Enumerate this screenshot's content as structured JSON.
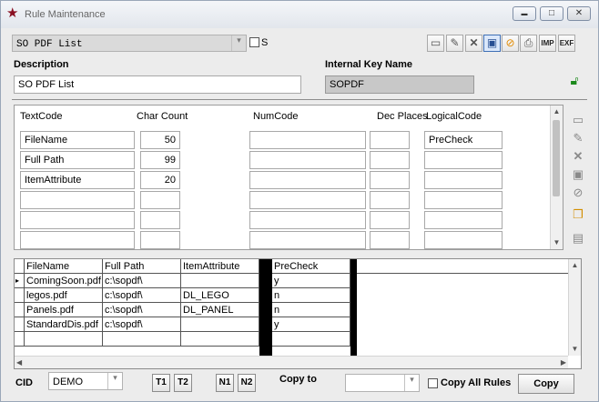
{
  "window": {
    "title": "Rule Maintenance",
    "minimize": "▬",
    "maximize": "□",
    "close": "✕"
  },
  "rule_select": {
    "value": "SO PDF List"
  },
  "s_checkbox": {
    "label": "S",
    "checked": false
  },
  "toolbar": {
    "imp_label": "IMP",
    "exf_label": "EXF"
  },
  "description": {
    "label": "Description",
    "value": "SO PDF List"
  },
  "internal_key": {
    "label": "Internal Key Name",
    "value": "SOPDF"
  },
  "fields_panel": {
    "headers": {
      "textcode": "TextCode",
      "charcount": "Char Count",
      "numcode": "NumCode",
      "decplaces": "Dec Places",
      "logicalcode": "LogicalCode"
    },
    "rows": [
      {
        "textcode": "FileName",
        "charcount": "50",
        "numcode": "",
        "decplaces": "",
        "logicalcode": "PreCheck"
      },
      {
        "textcode": "Full Path",
        "charcount": "99",
        "numcode": "",
        "decplaces": "",
        "logicalcode": ""
      },
      {
        "textcode": "ItemAttribute",
        "charcount": "20",
        "numcode": "",
        "decplaces": "",
        "logicalcode": ""
      },
      {
        "textcode": "",
        "charcount": "",
        "numcode": "",
        "decplaces": "",
        "logicalcode": ""
      },
      {
        "textcode": "",
        "charcount": "",
        "numcode": "",
        "decplaces": "",
        "logicalcode": ""
      },
      {
        "textcode": "",
        "charcount": "",
        "numcode": "",
        "decplaces": "",
        "logicalcode": ""
      },
      {
        "textcode": "",
        "charcount": "",
        "numcode": "",
        "decplaces": "",
        "logicalcode": ""
      }
    ]
  },
  "grid": {
    "columns": [
      "FileName",
      "Full Path",
      "ItemAttribute",
      "PreCheck"
    ],
    "rows": [
      {
        "filename": "ComingSoon.pdf",
        "fullpath": "c:\\sopdf\\",
        "itemattribute": "",
        "precheck": "y",
        "current": true
      },
      {
        "filename": "legos.pdf",
        "fullpath": "c:\\sopdf\\",
        "itemattribute": "DL_LEGO",
        "precheck": "n",
        "current": false
      },
      {
        "filename": "Panels.pdf",
        "fullpath": "c:\\sopdf\\",
        "itemattribute": "DL_PANEL",
        "precheck": "n",
        "current": false
      },
      {
        "filename": "StandardDis.pdf",
        "fullpath": "c:\\sopdf\\",
        "itemattribute": "",
        "precheck": "y",
        "current": false
      }
    ],
    "current_row_marker": "▸"
  },
  "bottom": {
    "cid_label": "CID",
    "cid_value": "DEMO",
    "t1": "T1",
    "t2": "T2",
    "n1": "N1",
    "n2": "N2",
    "copy_to_label": "Copy to",
    "copy_to_value": "",
    "copy_all_label": "Copy All Rules",
    "copy_button": "Copy"
  }
}
